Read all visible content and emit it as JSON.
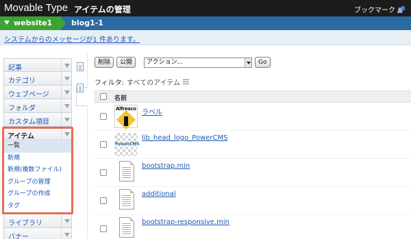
{
  "header": {
    "brand": "Movable Type",
    "title": "アイテムの管理",
    "bookmark_label": "ブックマーク"
  },
  "breadcrumb": {
    "website": "website1",
    "blog": "blog1-1"
  },
  "message": {
    "text": "システムからのメッセージが1 件あります。"
  },
  "sidebar": {
    "items_before": [
      {
        "label": "記事"
      },
      {
        "label": "カテゴリ"
      },
      {
        "label": "ウェブページ"
      },
      {
        "label": "フォルダ"
      },
      {
        "label": "カスタム項目"
      }
    ],
    "open_section": {
      "label": "アイテム",
      "subitems": [
        {
          "label": "一覧",
          "active": true
        },
        {
          "label": "新規"
        },
        {
          "label": "新規(複数ファイル)"
        },
        {
          "label": "グループの管理"
        },
        {
          "label": "グループの作成"
        },
        {
          "label": "タグ"
        }
      ]
    },
    "items_after": [
      {
        "label": "ライブラリ"
      },
      {
        "label": "バナー"
      }
    ]
  },
  "toolbar": {
    "delete_label": "削除",
    "publish_label": "公開",
    "action_select": "アクション...",
    "go_label": "Go"
  },
  "filter": {
    "label": "フィルタ:",
    "value": "すべてのアイテム"
  },
  "table": {
    "column_name": "名前",
    "rows": [
      {
        "name": "ラベル",
        "thumb": "alfresco",
        "thumb_text": "Alfresco"
      },
      {
        "name": "lib_head_logo_PowerCMS",
        "thumb": "powercms",
        "thumb_text": "PowerCMS"
      },
      {
        "name": "bootstrap.min",
        "thumb": "document"
      },
      {
        "name": "additional",
        "thumb": "document"
      },
      {
        "name": "bootstrap-responsive.min",
        "thumb": "document"
      }
    ]
  },
  "colors": {
    "header_bg": "#1c1c1c",
    "breadcrumb_bg": "#2b6aa2",
    "website_crumb_bg": "#3da235",
    "highlight_border": "#e46c55",
    "link": "#1a56b5"
  }
}
